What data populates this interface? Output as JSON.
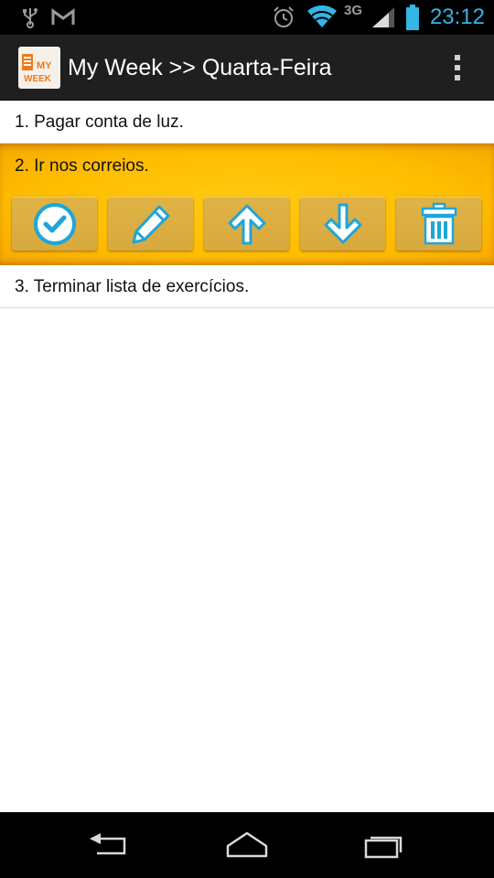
{
  "status_bar": {
    "time": "23:12",
    "network_type": "3G",
    "icons": [
      "usb-icon",
      "gmail-icon",
      "alarm-icon",
      "wifi-icon",
      "signal-icon",
      "battery-icon"
    ]
  },
  "action_bar": {
    "title": "My Week >> Quarta-Feira",
    "logo_line1": "MY",
    "logo_line2": "WEEK",
    "overflow_icon": "overflow-menu-icon"
  },
  "tasks": [
    {
      "label": "1. Pagar conta de luz."
    },
    {
      "label": "2. Ir nos correios."
    },
    {
      "label": "3. Terminar lista de exercícios."
    }
  ],
  "task_actions": [
    "check-icon",
    "edit-pencil-icon",
    "arrow-up-icon",
    "arrow-down-icon",
    "trash-icon"
  ],
  "colors": {
    "accent": "#33b5e5",
    "selected_row": "#ffbd00",
    "action_button": "#dcae42",
    "logo_text": "#f07a1a"
  },
  "nav_bar": {
    "icons": [
      "back-icon",
      "home-icon",
      "recent-apps-icon"
    ]
  }
}
